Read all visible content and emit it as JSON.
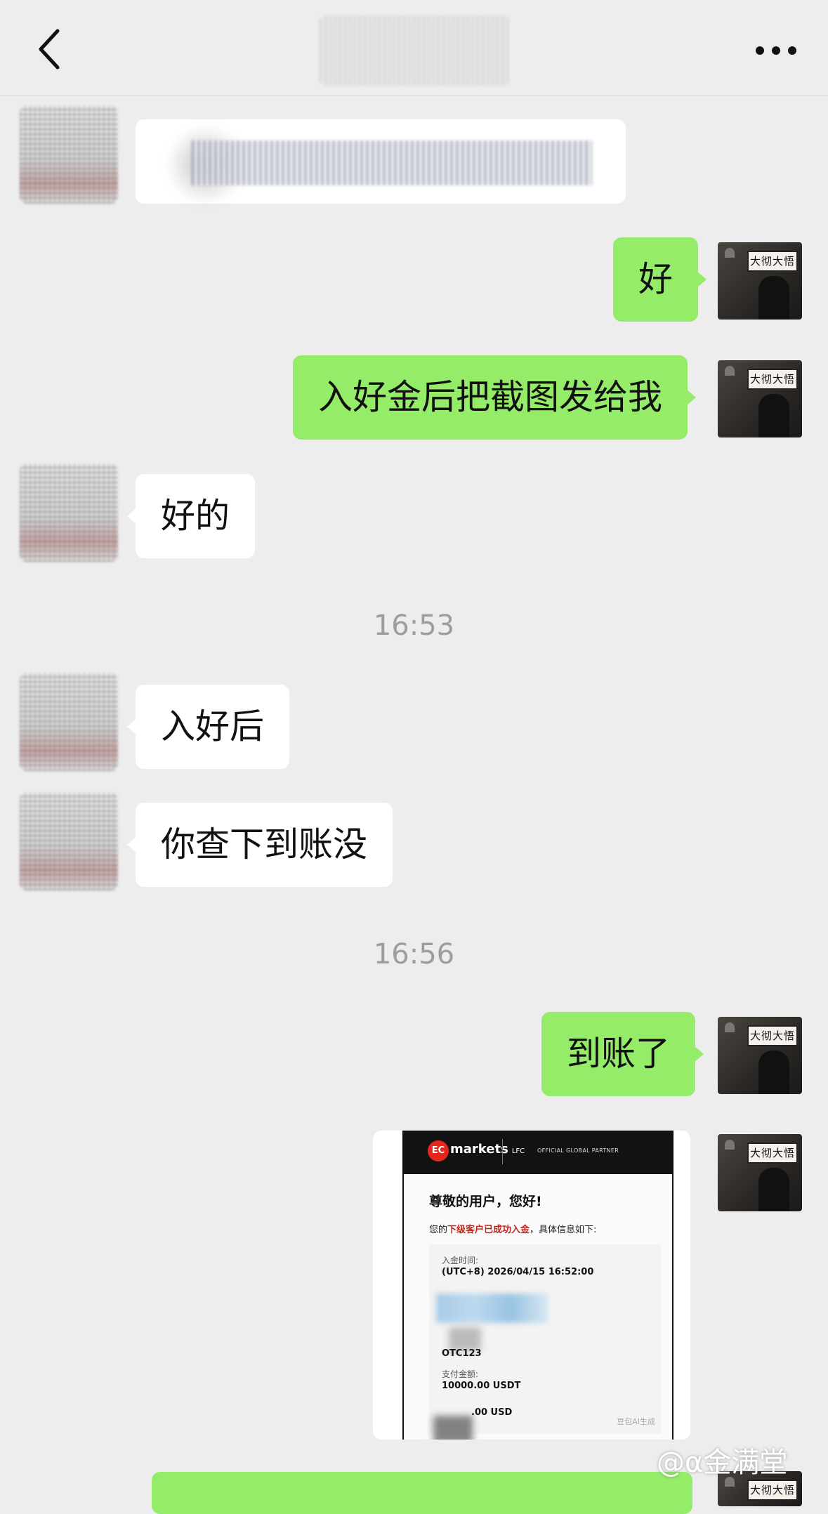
{
  "header": {
    "back_icon": "chevron-left-icon",
    "more_icon": "more-dots-icon"
  },
  "messages": [
    {
      "side": "in",
      "text": ""
    },
    {
      "side": "out",
      "text": "好"
    },
    {
      "side": "out",
      "text": "入好金后把截图发给我"
    },
    {
      "side": "in",
      "text": "好的"
    },
    {
      "side": "time",
      "text": "16:53"
    },
    {
      "side": "in",
      "text": "入好后"
    },
    {
      "side": "in",
      "text": "你查下到账没"
    },
    {
      "side": "time",
      "text": "16:56"
    },
    {
      "side": "out",
      "text": "到账了"
    }
  ],
  "image_card": {
    "logo_text": "EC",
    "brand": "markets",
    "club": "LFC",
    "partner": "OFFICIAL GLOBAL PARTNER",
    "greeting": "尊敬的用户，您好!",
    "line_prefix": "您的",
    "line_highlight": "下级客户已成功入金",
    "line_suffix": "，具体信息如下:",
    "deposit_time_label": "入金时间:",
    "deposit_time_value": "(UTC+8) 2026/04/15 16:52:00",
    "method_value": "OTC123",
    "pay_amount_label": "支付金额:",
    "pay_amount_value": "10000.00 USDT",
    "received_value": ".00 USD",
    "ai_mark": "豆包AI生成"
  },
  "watermark": "@α金满堂",
  "colors": {
    "background": "#ededed",
    "incoming_bubble": "#ffffff",
    "outgoing_bubble": "#95ec69",
    "timestamp": "#9d9d9d",
    "highlight": "#c0261c"
  }
}
